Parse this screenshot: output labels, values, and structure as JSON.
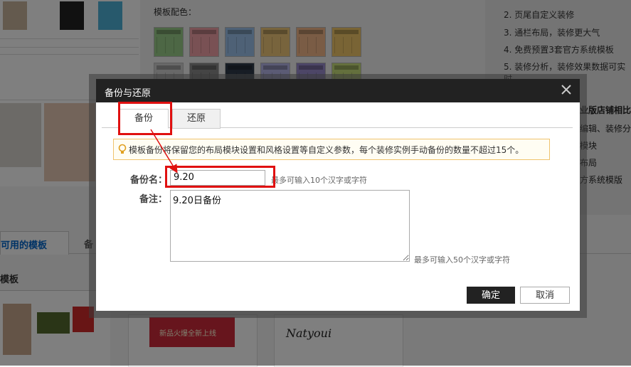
{
  "background": {
    "palette_heading": "模板配色：",
    "features": [
      "2. 页尾自定义装修",
      "3. 通栏布局，装修更大气",
      "4. 免费预置3套官方系统模板",
      "5. 装修分析，装修效果数据可实时"
    ],
    "features_right": [
      "业版店铺相比",
      "编辑、装修分",
      "模块",
      "布局",
      "方系统模版"
    ],
    "tabs": [
      "可用的模板",
      "备"
    ],
    "section_title": "模板",
    "promo_text": "新品火爆全新上线",
    "brand_text": "Natyoui"
  },
  "dialog": {
    "title": "备份与还原",
    "tabs": [
      "备份",
      "还原"
    ],
    "notice": "模板备份将保留您的布局模块设置和风格设置等自定义参数，每个装修实例手动备份的数量不超过15个。",
    "name_label": "备份名：",
    "name_value": "9.20",
    "name_hint": "最多可输入10个汉字或字符",
    "note_label": "备注：",
    "note_value": "9.20日备份",
    "note_hint": "最多可输入50个汉字或字符",
    "ok_label": "确定",
    "cancel_label": "取消"
  },
  "colors": {
    "header": "#222222",
    "highlight": "#e01010",
    "notice_border": "#f0c36d",
    "swatches": [
      "#9bcf8a",
      "#f3a3a8",
      "#9cc3ec",
      "#f1c97a",
      "#f4b98a",
      "#f2c86a",
      "#d0d0d0",
      "#8a8a8a",
      "#2f3a4a",
      "#b7b7ea",
      "#9b8ccf",
      "#c8e07a"
    ]
  }
}
